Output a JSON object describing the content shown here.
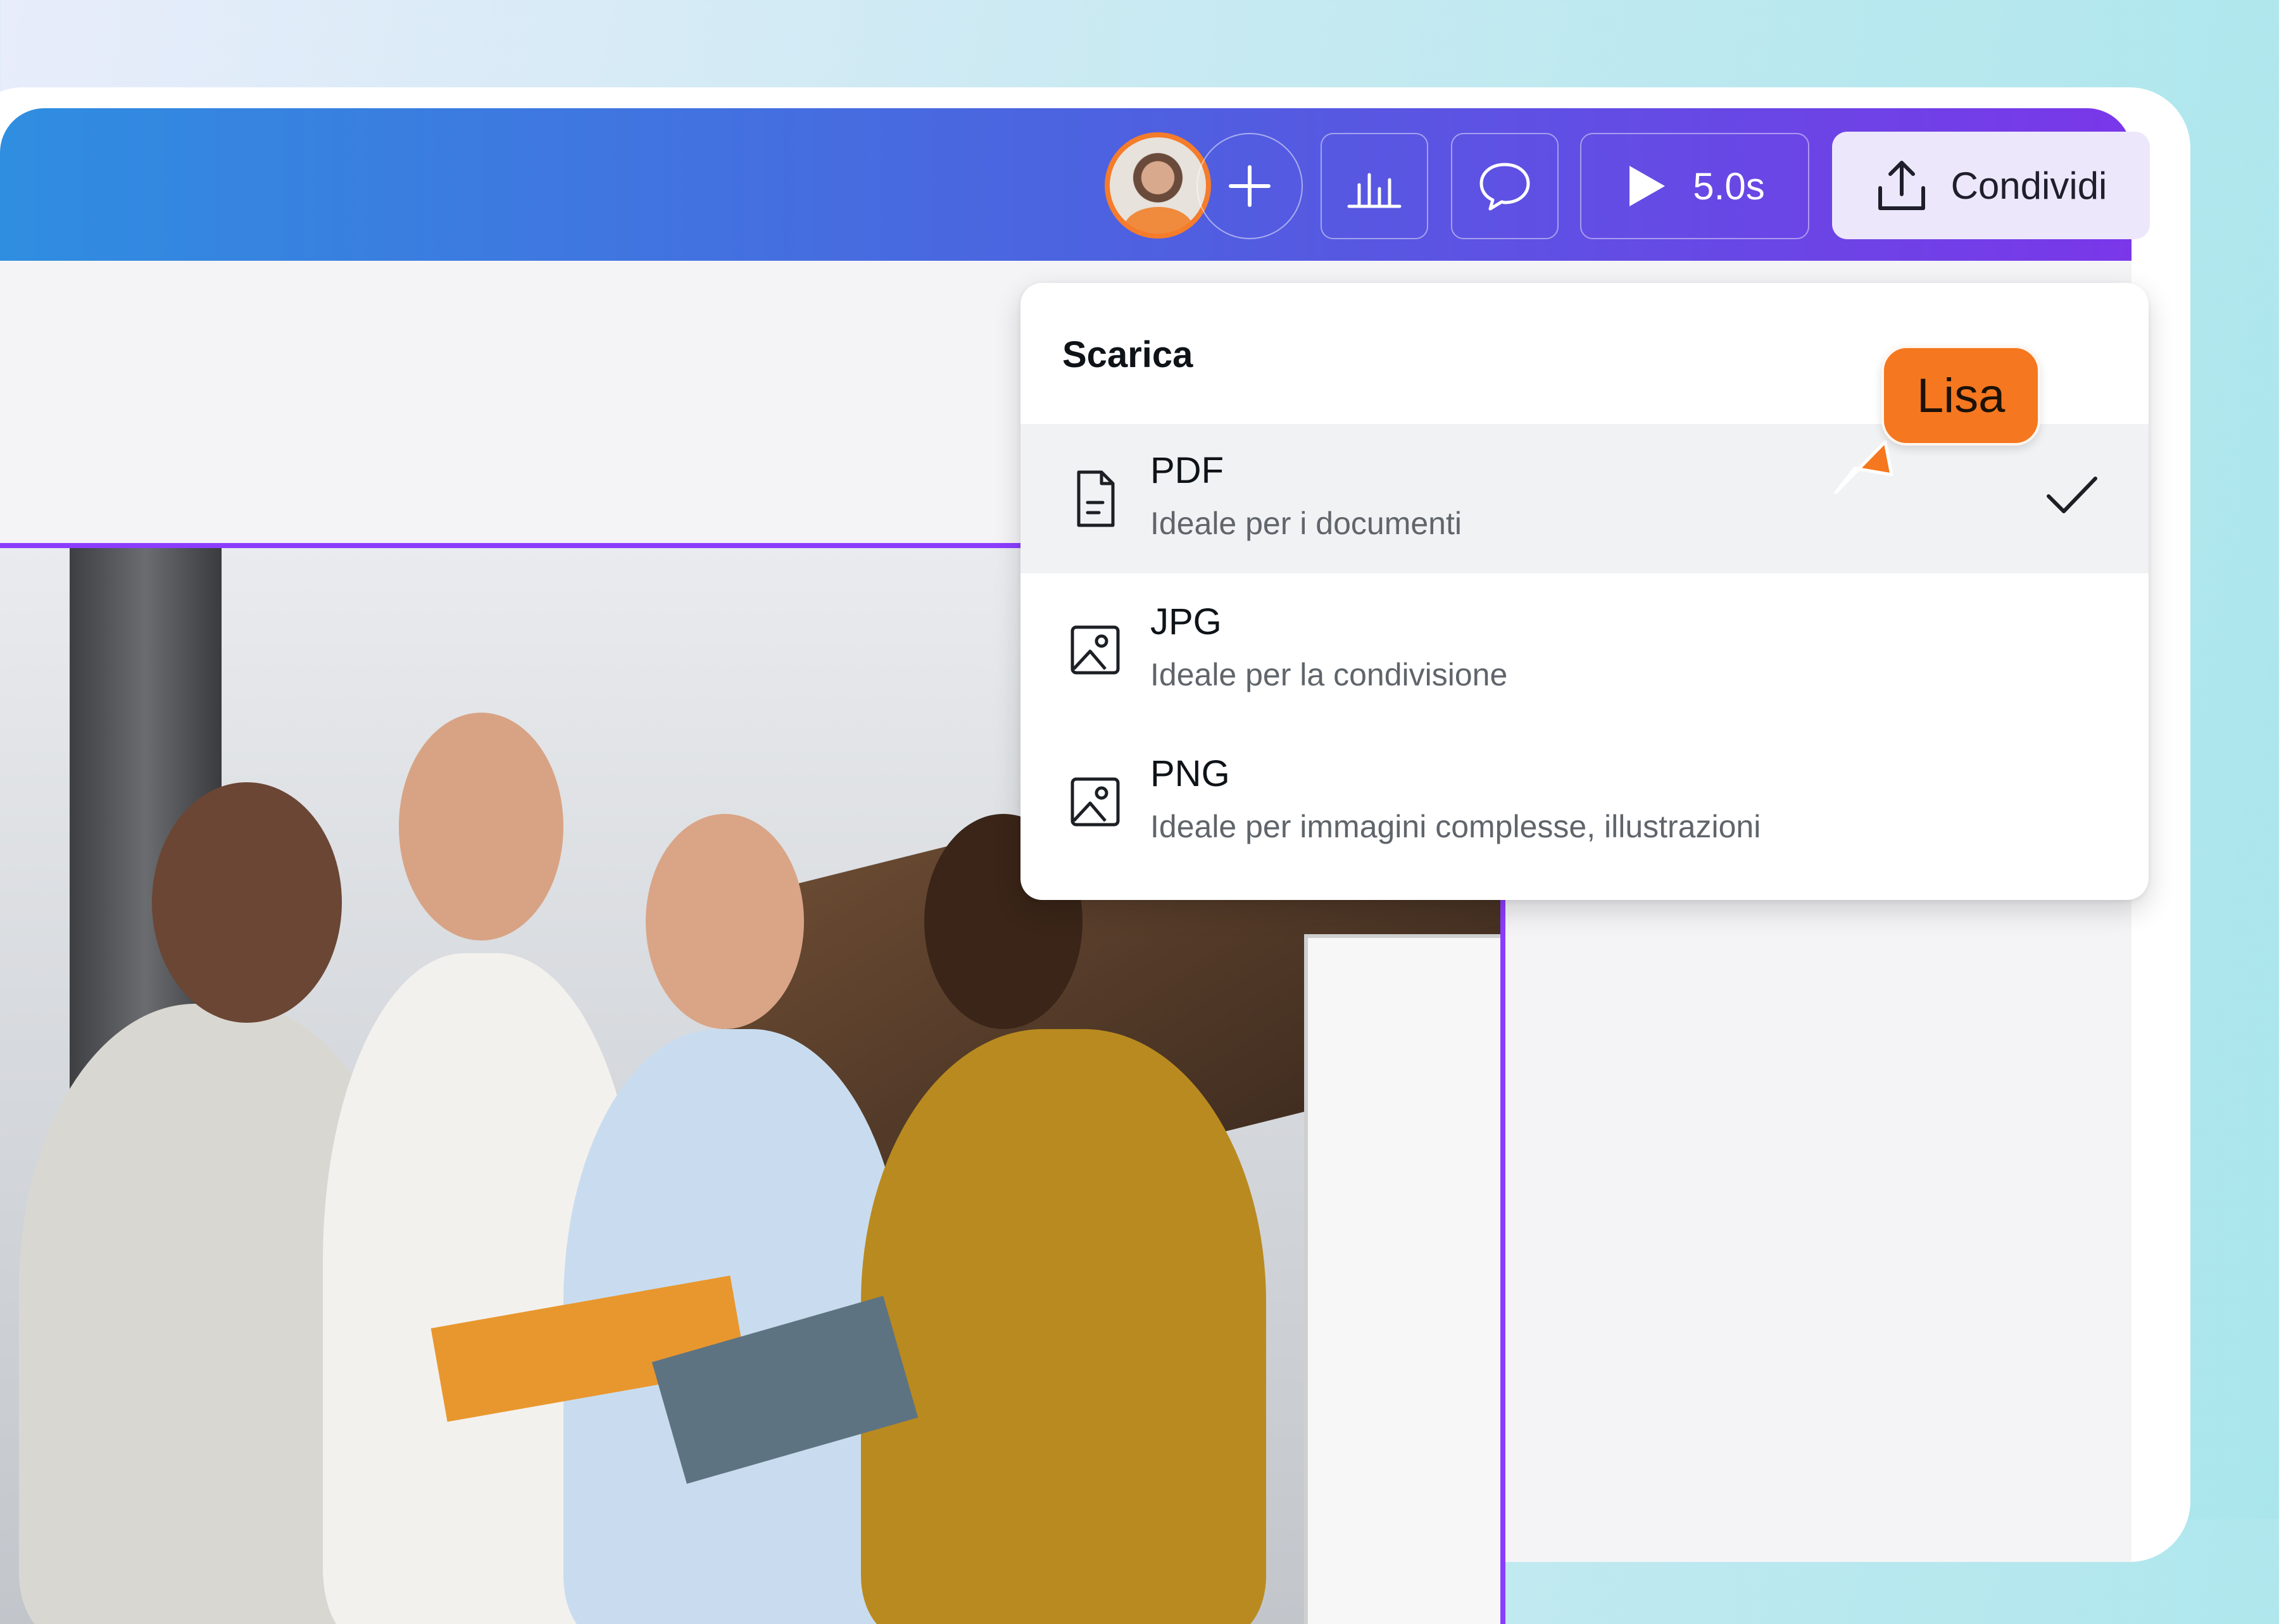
{
  "toolbar": {
    "add_collaborator_icon": "plus-icon",
    "insights_icon": "bar-chart-icon",
    "comment_icon": "speech-bubble-icon",
    "play_duration": "5.0s",
    "share_label": "Condividi",
    "share_icon": "upload-icon"
  },
  "download_menu": {
    "title": "Scarica",
    "options": [
      {
        "label": "PDF",
        "description": "Ideale per i documenti",
        "icon": "document-icon",
        "selected": true
      },
      {
        "label": "JPG",
        "description": "Ideale per la condivisione",
        "icon": "image-icon",
        "selected": false
      },
      {
        "label": "PNG",
        "description": "Ideale per immagini complesse, illustrazioni",
        "icon": "image-icon",
        "selected": false
      }
    ]
  },
  "collaborator_cursor": {
    "name": "Lisa",
    "color": "#f5771f"
  },
  "colors": {
    "header_gradient_start": "#2f8ee0",
    "header_gradient_end": "#7a37e9",
    "selection_outline": "#8b3dff",
    "avatar_ring": "#f57c2a"
  }
}
